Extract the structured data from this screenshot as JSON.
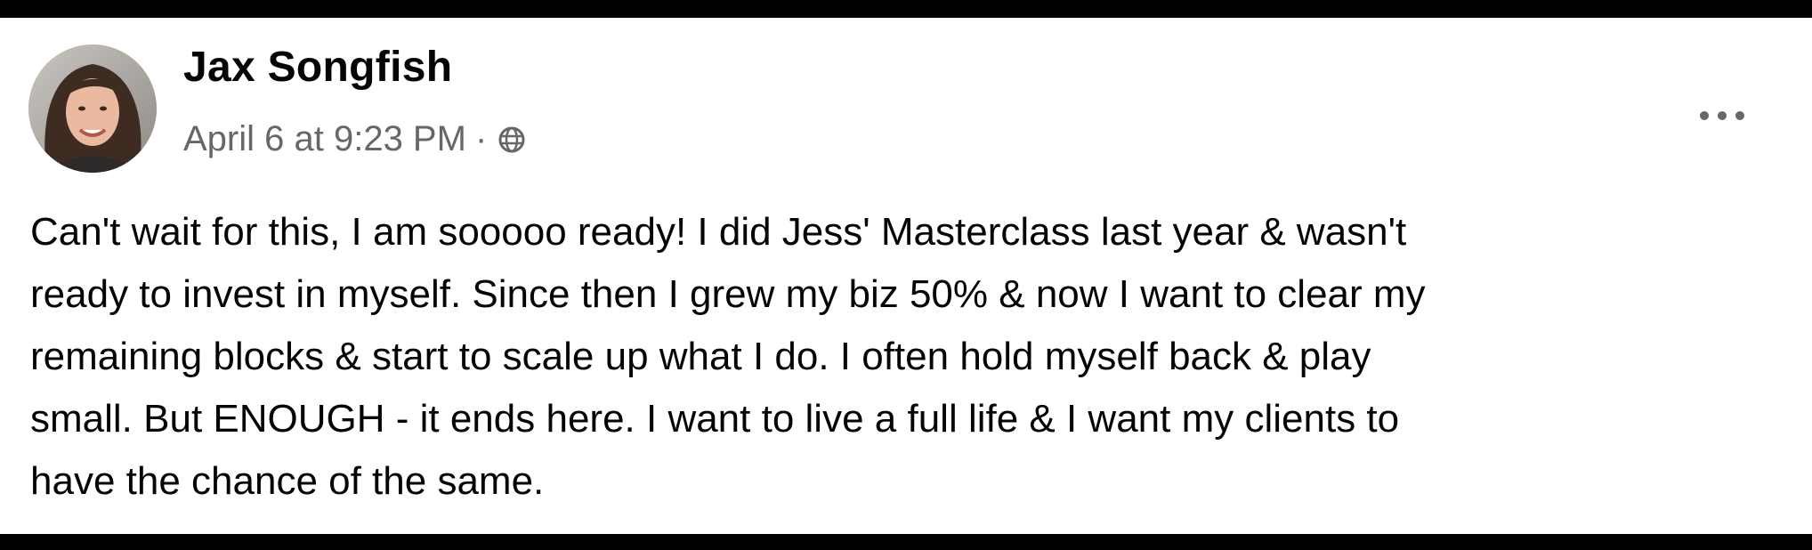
{
  "post": {
    "author": "Jax Songfish",
    "timestamp": "April 6 at 9:23 PM",
    "separator": "·",
    "audience_icon": "globe-icon",
    "more_icon": "more-options-icon",
    "lines": [
      "Can't wait for this, I am sooooo ready! I did Jess' Masterclass last year & wasn't",
      "ready to invest in myself. Since then I grew my biz 50% & now I want to clear my",
      "remaining blocks & start to scale up what I do. I often hold myself back & play",
      "small. But ENOUGH - it ends here. I want to live a full life & I want my clients to",
      "have the chance of the same."
    ]
  },
  "colors": {
    "text_primary": "#050505",
    "text_secondary": "#65676b",
    "background": "#ffffff",
    "frame": "#000000"
  }
}
